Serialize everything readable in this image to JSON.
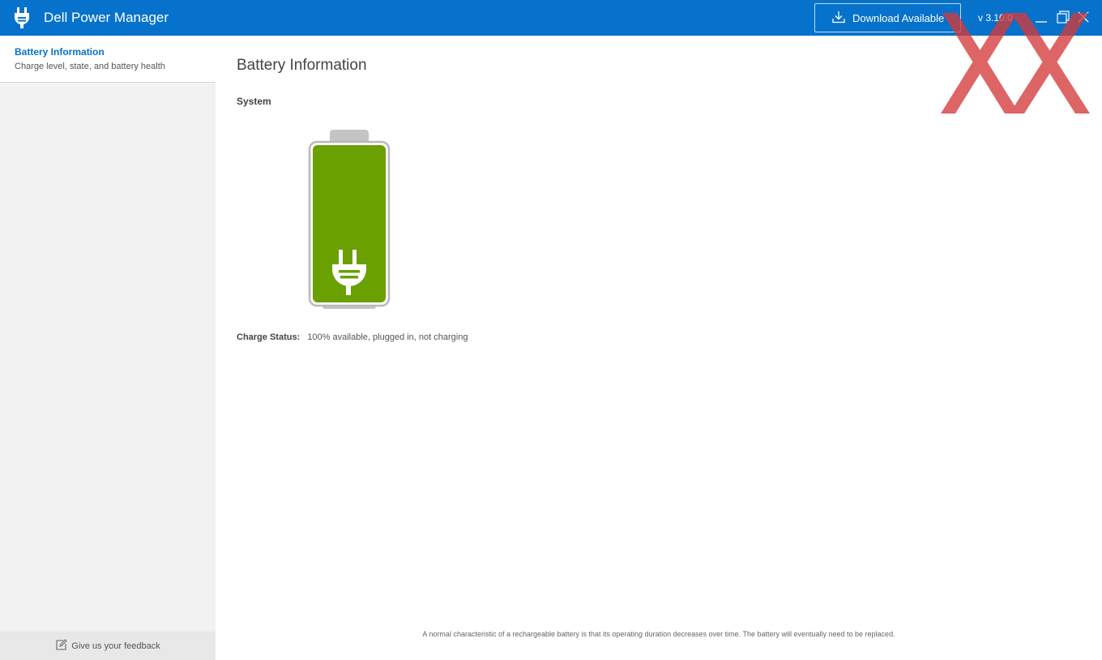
{
  "titlebar": {
    "app_title": "Dell Power Manager",
    "app_icon": "power-plug-icon",
    "download_label": "Download Available",
    "download_icon": "download-icon",
    "version": "v 3.10.0",
    "color": "#0672cb"
  },
  "sidebar": {
    "items": [
      {
        "label": "Battery Information",
        "sublabel": "Charge level, state, and battery health",
        "selected": true
      }
    ],
    "feedback_label": "Give us your feedback",
    "feedback_icon": "edit-icon"
  },
  "main": {
    "page_title": "Battery Information",
    "section_title": "System",
    "battery": {
      "charge_percent": 100,
      "plugged_in": true,
      "fill_color": "#6aa000",
      "icon": "plug-icon"
    },
    "charge_status_label": "Charge Status:",
    "charge_status_value": "100% available, plugged in, not charging",
    "footer_note": "A normal characteristic of a rechargeable battery is that its operating duration decreases over time. The battery will eventually need to be replaced."
  }
}
